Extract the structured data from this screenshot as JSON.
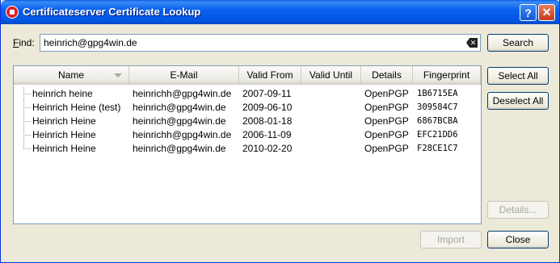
{
  "window": {
    "title": "Certificateserver Certificate Lookup",
    "help_glyph": "?",
    "close_glyph": "✕"
  },
  "find": {
    "label_prefix": "F",
    "label_rest": "ind:",
    "value": "heinrich@gpg4win.de"
  },
  "buttons": {
    "search": "Search",
    "select_all": "Select All",
    "deselect_all": "Deselect All",
    "details": "Details...",
    "import": "Import",
    "close": "Close"
  },
  "table": {
    "columns": [
      "Name",
      "E-Mail",
      "Valid From",
      "Valid Until",
      "Details",
      "Fingerprint"
    ],
    "rows": [
      {
        "name": "heinrich heine",
        "email": "heinrichh@gpg4win.de",
        "valid_from": "2007-09-11",
        "valid_until": "",
        "details": "OpenPGP",
        "fingerprint": "1B6715EA"
      },
      {
        "name": "Heinrich Heine (test)",
        "email": "heinrich@gpg4win.de",
        "valid_from": "2009-06-10",
        "valid_until": "",
        "details": "OpenPGP",
        "fingerprint": "309584C7"
      },
      {
        "name": "Heinrich Heine",
        "email": "heinrich@gpg4win.de",
        "valid_from": "2008-01-18",
        "valid_until": "",
        "details": "OpenPGP",
        "fingerprint": "6867BCBA"
      },
      {
        "name": "Heinrich Heine",
        "email": "heinrichh@gpg4win.de",
        "valid_from": "2006-11-09",
        "valid_until": "",
        "details": "OpenPGP",
        "fingerprint": "EFC21DD6"
      },
      {
        "name": "Heinrich Heine",
        "email": "heinrich@gpg4win.de",
        "valid_from": "2010-02-20",
        "valid_until": "",
        "details": "OpenPGP",
        "fingerprint": "F28CE1C7"
      }
    ]
  }
}
